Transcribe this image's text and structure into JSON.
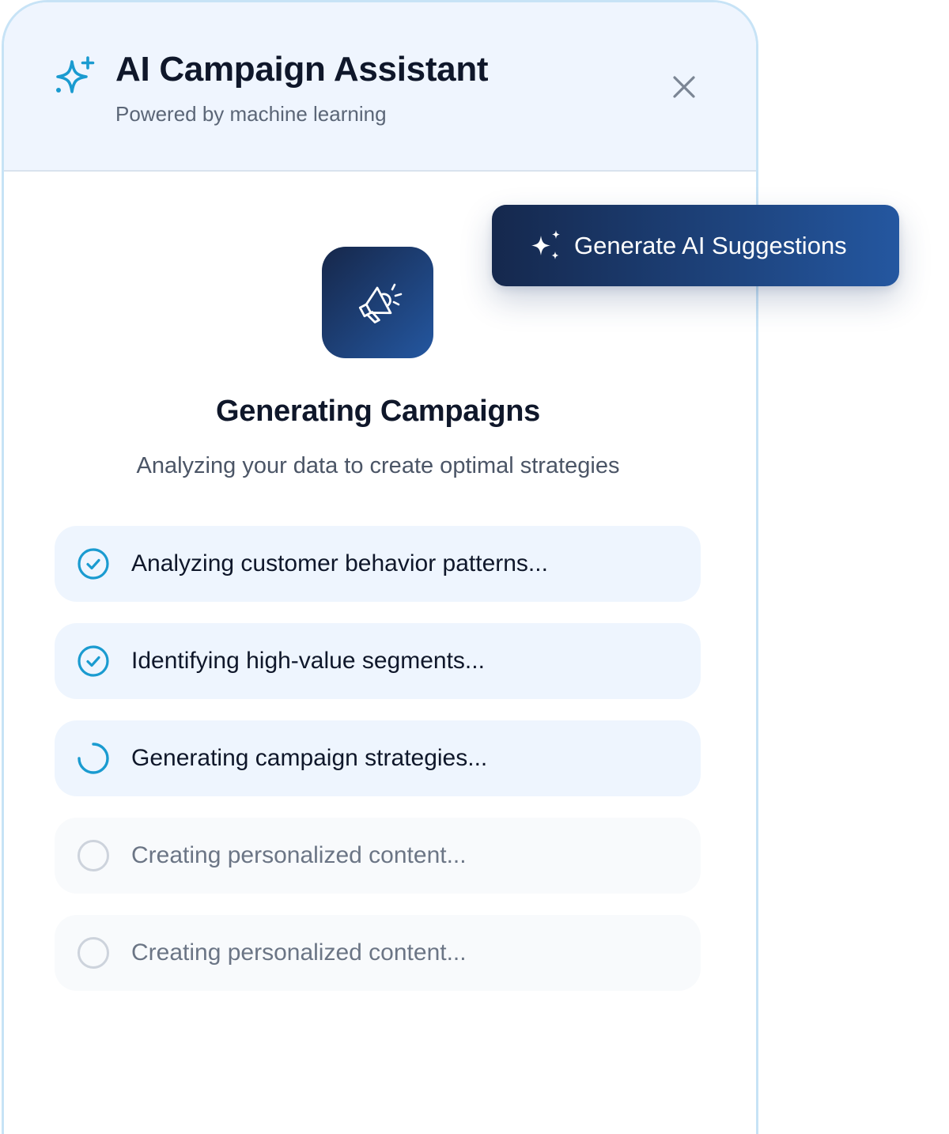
{
  "panel": {
    "header": {
      "title": "AI Campaign Assistant",
      "subtitle": "Powered by machine learning",
      "icon": "sparkle-icon",
      "close_icon": "close-icon"
    },
    "hero_icon": "megaphone-icon",
    "heading": "Generating Campaigns",
    "description": "Analyzing your data to create optimal strategies",
    "steps": [
      {
        "label": "Analyzing customer behavior patterns...",
        "status": "complete",
        "icon": "check-circle-icon"
      },
      {
        "label": "Identifying high-value segments...",
        "status": "complete",
        "icon": "check-circle-icon"
      },
      {
        "label": "Generating campaign strategies...",
        "status": "in-progress",
        "icon": "spinner-icon"
      },
      {
        "label": "Creating personalized content...",
        "status": "pending",
        "icon": "empty-circle-icon"
      },
      {
        "label": "Creating personalized content...",
        "status": "pending",
        "icon": "empty-circle-icon"
      }
    ]
  },
  "generate_button": {
    "label": "Generate AI Suggestions",
    "icon": "sparkles-icon"
  },
  "colors": {
    "accent": "#1a9bd0",
    "gradient_start": "#15284d",
    "gradient_end": "#2457a0",
    "header_bg": "#eff5fe",
    "step_active_bg": "#eef5fe",
    "step_pending_bg": "#f8fafc"
  }
}
